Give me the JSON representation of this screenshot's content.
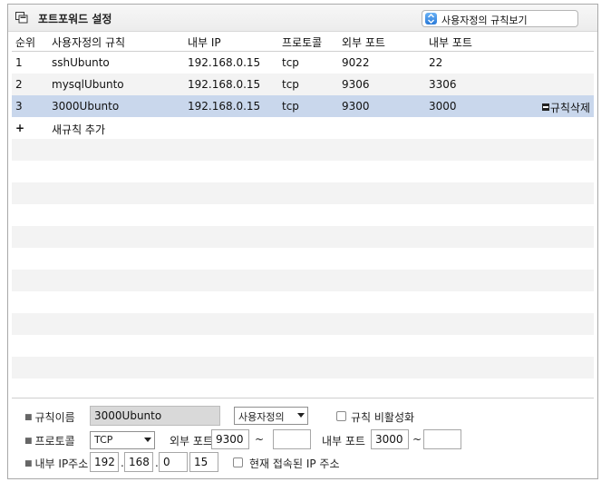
{
  "header": {
    "title": "포트포워드 설정",
    "view_select_label": "사용자정의 규칙보기"
  },
  "table": {
    "columns": [
      "순위",
      "사용자정의 규칙",
      "내부 IP",
      "프로토콜",
      "외부 포트",
      "내부 포트"
    ],
    "rows": [
      {
        "order": "1",
        "name": "sshUbunto",
        "ip": "192.168.0.15",
        "protocol": "tcp",
        "ext_port": "9022",
        "int_port": "22"
      },
      {
        "order": "2",
        "name": "mysqlUbunto",
        "ip": "192.168.0.15",
        "protocol": "tcp",
        "ext_port": "9306",
        "int_port": "3306"
      },
      {
        "order": "3",
        "name": "3000Ubunto",
        "ip": "192.168.0.15",
        "protocol": "tcp",
        "ext_port": "9300",
        "int_port": "3000",
        "action": "규칙삭제"
      }
    ],
    "add_rule": {
      "plus": "+",
      "label": "새규칙 추가"
    }
  },
  "form": {
    "rule_name_label": "규칙이름",
    "rule_name_value": "3000Ubunto",
    "rule_type_value": "사용자정의",
    "disable_label": "규칙 비활성화",
    "protocol_label": "프로토콜",
    "protocol_value": "TCP",
    "ext_port_label": "외부 포트",
    "ext_port_from": "9300",
    "ext_port_to": "",
    "int_port_label": "내부 포트",
    "int_port_from": "3000",
    "int_port_to": "",
    "range_sep": "~",
    "ip_label": "내부 IP주소",
    "ip_octets": [
      "192",
      "168",
      "0",
      "15"
    ],
    "ip_dot": ".",
    "current_ip_label": "현재 접속된 IP 주소"
  },
  "colors": {
    "selected_row": "#c9d7ec",
    "link_blue": "#3d86e0",
    "alt_row": "#f3f3f3"
  }
}
